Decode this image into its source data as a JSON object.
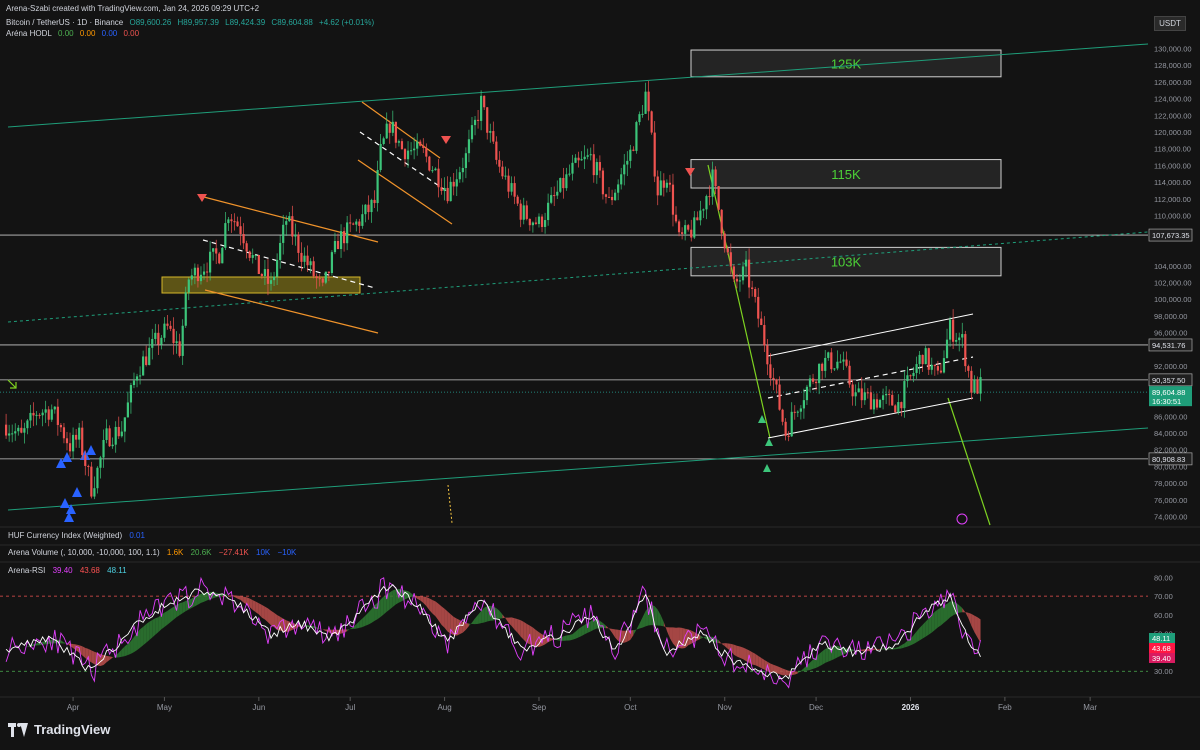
{
  "header": {
    "created_by": "Arena-Szabi created with TradingView.com, Jan 24, 2026 09:29 UTC+2",
    "symbol": "Bitcoin / TetherUS · 1D · Binance",
    "open": "O89,600.26",
    "high": "H89,957.39",
    "low": "L89,424.39",
    "close": "C89,604.88",
    "change": "+4.62 (+0.01%)",
    "indicator_name": "Aréna HODL",
    "indicator_values": [
      "0.00",
      "0.00",
      "0.00",
      "0.00"
    ]
  },
  "currency_pill": "USDT",
  "pane_labels": {
    "huf": {
      "name": "HUF Currency Index (Weighted)",
      "value": "0.01"
    },
    "volume": {
      "name": "Arena Volume (, 10,000, -10,000, 100, 1.1)",
      "values": [
        "1.6K",
        "20.6K",
        "−27.41K",
        "10K",
        "−10K"
      ]
    },
    "rsi": {
      "name": "Arena-RSI",
      "values": [
        "39.40",
        "43.68",
        "48.11"
      ]
    }
  },
  "brand": "TradingView",
  "colors": {
    "up": "#26a69a",
    "up_bright": "#3cc57a",
    "down": "#ef5350",
    "channel": "#1f9e7a",
    "zone_text": "#4cd137",
    "orange": "#f0932b",
    "rsi_fast": "#e040fb",
    "rsi_slow": "#ffffff",
    "fill_bull": "#2e7d32",
    "fill_bear": "#c0504d"
  },
  "chart_data": {
    "type": "candlestick",
    "price_axis": {
      "ticks": [
        "130,000.00",
        "128,000.00",
        "126,000.00",
        "124,000.00",
        "122,000.00",
        "120,000.00",
        "118,000.00",
        "116,000.00",
        "114,000.00",
        "112,000.00",
        "110,000.00",
        "104,000.00",
        "102,000.00",
        "100,000.00",
        "98,000.00",
        "96,000.00",
        "92,000.00",
        "88,000.00",
        "86,000.00",
        "84,000.00",
        "82,000.00",
        "80,000.00",
        "78,000.00",
        "76,000.00",
        "74,000.00"
      ],
      "ylim": [
        73000,
        131000
      ]
    },
    "time_axis": {
      "labels": [
        "Apr",
        "May",
        "Jun",
        "Jul",
        "Aug",
        "Sep",
        "Oct",
        "Nov",
        "Dec",
        "2026",
        "Feb",
        "Mar"
      ]
    },
    "levels": [
      {
        "label": "107,673.35",
        "value": 107673.35
      },
      {
        "label": "94,531.76",
        "value": 94531.76
      },
      {
        "label": "90,357.50",
        "value": 90357.5
      },
      {
        "label": "80,908.83",
        "value": 80908.83
      }
    ],
    "current_price": {
      "price": "89,604.88",
      "countdown": "16:30:51",
      "value": 89604.88
    },
    "zones": [
      {
        "label": "125K",
        "high": 129800,
        "low": 126600
      },
      {
        "label": "115K",
        "high": 116700,
        "low": 113300
      },
      {
        "label": "103K",
        "high": 106200,
        "low": 102800
      }
    ],
    "price_path": [
      {
        "d": "2025-03-10",
        "p": 85000
      },
      {
        "d": "2025-03-15",
        "p": 83500
      },
      {
        "d": "2025-03-20",
        "p": 86500
      },
      {
        "d": "2025-03-25",
        "p": 86800
      },
      {
        "d": "2025-03-31",
        "p": 82500
      },
      {
        "d": "2025-04-03",
        "p": 83500
      },
      {
        "d": "2025-04-07",
        "p": 77500
      },
      {
        "d": "2025-04-09",
        "p": 79500
      },
      {
        "d": "2025-04-12",
        "p": 83500
      },
      {
        "d": "2025-04-17",
        "p": 84500
      },
      {
        "d": "2025-04-22",
        "p": 91500
      },
      {
        "d": "2025-04-28",
        "p": 94800
      },
      {
        "d": "2025-05-02",
        "p": 96500
      },
      {
        "d": "2025-05-06",
        "p": 94000
      },
      {
        "d": "2025-05-09",
        "p": 102500
      },
      {
        "d": "2025-05-14",
        "p": 104000
      },
      {
        "d": "2025-05-19",
        "p": 105500
      },
      {
        "d": "2025-05-22",
        "p": 110500
      },
      {
        "d": "2025-05-26",
        "p": 108500
      },
      {
        "d": "2025-05-31",
        "p": 104000
      },
      {
        "d": "2025-06-05",
        "p": 101500
      },
      {
        "d": "2025-06-10",
        "p": 109500
      },
      {
        "d": "2025-06-15",
        "p": 105500
      },
      {
        "d": "2025-06-22",
        "p": 101000
      },
      {
        "d": "2025-06-27",
        "p": 107000
      },
      {
        "d": "2025-07-03",
        "p": 109000
      },
      {
        "d": "2025-07-09",
        "p": 111500
      },
      {
        "d": "2025-07-11",
        "p": 117500
      },
      {
        "d": "2025-07-14",
        "p": 121000
      },
      {
        "d": "2025-07-18",
        "p": 118000
      },
      {
        "d": "2025-07-25",
        "p": 117500
      },
      {
        "d": "2025-08-02",
        "p": 113000
      },
      {
        "d": "2025-08-08",
        "p": 117000
      },
      {
        "d": "2025-08-13",
        "p": 123500
      },
      {
        "d": "2025-08-18",
        "p": 116500
      },
      {
        "d": "2025-08-26",
        "p": 110500
      },
      {
        "d": "2025-09-01",
        "p": 109000
      },
      {
        "d": "2025-09-05",
        "p": 111500
      },
      {
        "d": "2025-09-12",
        "p": 115500
      },
      {
        "d": "2025-09-18",
        "p": 117000
      },
      {
        "d": "2025-09-24",
        "p": 111500
      },
      {
        "d": "2025-10-01",
        "p": 117500
      },
      {
        "d": "2025-10-06",
        "p": 124500
      },
      {
        "d": "2025-10-10",
        "p": 113000
      },
      {
        "d": "2025-10-13",
        "p": 115000
      },
      {
        "d": "2025-10-17",
        "p": 107000
      },
      {
        "d": "2025-10-22",
        "p": 108500
      },
      {
        "d": "2025-10-28",
        "p": 114500
      },
      {
        "d": "2025-11-04",
        "p": 101500
      },
      {
        "d": "2025-11-08",
        "p": 103500
      },
      {
        "d": "2025-11-14",
        "p": 95000
      },
      {
        "d": "2025-11-21",
        "p": 84000
      },
      {
        "d": "2025-11-25",
        "p": 87500
      },
      {
        "d": "2025-12-03",
        "p": 92500
      },
      {
        "d": "2025-12-09",
        "p": 92500
      },
      {
        "d": "2025-12-14",
        "p": 88500
      },
      {
        "d": "2025-12-20",
        "p": 88000
      },
      {
        "d": "2025-12-28",
        "p": 87500
      },
      {
        "d": "2026-01-05",
        "p": 93500
      },
      {
        "d": "2026-01-10",
        "p": 90500
      },
      {
        "d": "2026-01-14",
        "p": 96500
      },
      {
        "d": "2026-01-18",
        "p": 95000
      },
      {
        "d": "2026-01-21",
        "p": 89500
      },
      {
        "d": "2026-01-24",
        "p": 89600
      }
    ],
    "rsi_axis": {
      "ticks": [
        "80.00",
        "70.00",
        "60.00",
        "50.00",
        "40.00",
        "30.00"
      ],
      "ylim": [
        20,
        85
      ]
    },
    "rsi_path": [
      {
        "d": "2025-03-10",
        "v": 42
      },
      {
        "d": "2025-03-25",
        "v": 48
      },
      {
        "d": "2025-04-07",
        "v": 30
      },
      {
        "d": "2025-04-20",
        "v": 52
      },
      {
        "d": "2025-05-01",
        "v": 65
      },
      {
        "d": "2025-05-12",
        "v": 73
      },
      {
        "d": "2025-05-22",
        "v": 70
      },
      {
        "d": "2025-06-05",
        "v": 50
      },
      {
        "d": "2025-06-15",
        "v": 55
      },
      {
        "d": "2025-06-25",
        "v": 48
      },
      {
        "d": "2025-07-05",
        "v": 62
      },
      {
        "d": "2025-07-14",
        "v": 77
      },
      {
        "d": "2025-07-25",
        "v": 62
      },
      {
        "d": "2025-08-02",
        "v": 45
      },
      {
        "d": "2025-08-13",
        "v": 68
      },
      {
        "d": "2025-08-26",
        "v": 42
      },
      {
        "d": "2025-09-08",
        "v": 50
      },
      {
        "d": "2025-09-18",
        "v": 60
      },
      {
        "d": "2025-09-26",
        "v": 40
      },
      {
        "d": "2025-10-06",
        "v": 72
      },
      {
        "d": "2025-10-12",
        "v": 40
      },
      {
        "d": "2025-10-24",
        "v": 50
      },
      {
        "d": "2025-11-04",
        "v": 35
      },
      {
        "d": "2025-11-21",
        "v": 26
      },
      {
        "d": "2025-12-03",
        "v": 45
      },
      {
        "d": "2025-12-14",
        "v": 40
      },
      {
        "d": "2025-12-28",
        "v": 45
      },
      {
        "d": "2026-01-05",
        "v": 60
      },
      {
        "d": "2026-01-14",
        "v": 70
      },
      {
        "d": "2026-01-21",
        "v": 42
      },
      {
        "d": "2026-01-24",
        "v": 40
      }
    ]
  }
}
